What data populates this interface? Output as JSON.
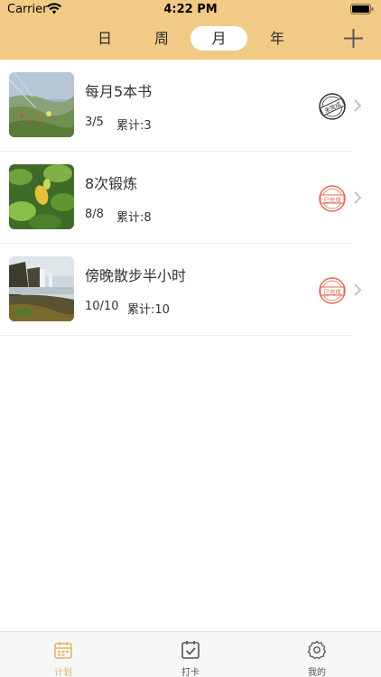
{
  "status_bar": {
    "carrier": "Carrier",
    "time": "4:22 PM"
  },
  "header": {
    "segments": {
      "day": "日",
      "week": "周",
      "month": "月",
      "year": "年"
    },
    "selected_segment": "月",
    "add_icon": "plus-icon",
    "background_color": "#f1cb86"
  },
  "plans": [
    {
      "title": "每月5本书",
      "progress": "3/5",
      "total": "累计:3",
      "stamp_text": "未完成",
      "stamp_color": "#333333"
    },
    {
      "title": "8次锻炼",
      "progress": "8/8",
      "total": "累计:8",
      "stamp_text": "已完成",
      "stamp_color": "#e06a55"
    },
    {
      "title": "傍晚散步半小时",
      "progress": "10/10",
      "total": "累计:10",
      "stamp_text": "已完成",
      "stamp_color": "#e06a55"
    }
  ],
  "tab_bar": {
    "tabs": [
      {
        "label": "计划",
        "icon": "calendar-icon",
        "active": true
      },
      {
        "label": "打卡",
        "icon": "checkin-icon",
        "active": false
      },
      {
        "label": "我的",
        "icon": "gear-icon",
        "active": false
      }
    ],
    "active_color": "#e6b466"
  }
}
